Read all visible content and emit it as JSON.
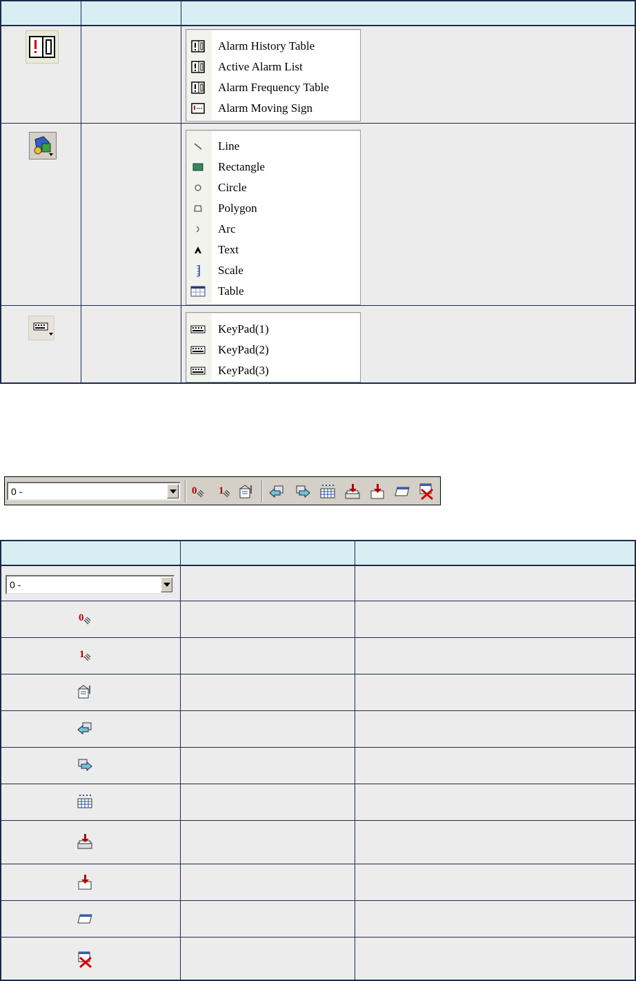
{
  "table1": {
    "headers": [
      "",
      "",
      ""
    ],
    "rows": [
      {
        "icon": "alarm-icon",
        "menu": [
          {
            "icon": "alarm-history-icon",
            "label": "Alarm History Table"
          },
          {
            "icon": "active-alarm-icon",
            "label": "Active Alarm List"
          },
          {
            "icon": "alarm-frequency-icon",
            "label": "Alarm Frequency Table"
          },
          {
            "icon": "alarm-moving-sign-icon",
            "label": "Alarm Moving Sign"
          }
        ]
      },
      {
        "icon": "drawing-tools-icon",
        "menu": [
          {
            "icon": "line-icon",
            "label": "Line"
          },
          {
            "icon": "rectangle-icon",
            "label": "Rectangle"
          },
          {
            "icon": "circle-icon",
            "label": "Circle"
          },
          {
            "icon": "polygon-icon",
            "label": "Polygon"
          },
          {
            "icon": "arc-icon",
            "label": "Arc"
          },
          {
            "icon": "text-icon",
            "label": "Text"
          },
          {
            "icon": "scale-icon",
            "label": "Scale"
          },
          {
            "icon": "table-icon",
            "label": "Table"
          }
        ]
      },
      {
        "icon": "keypad-icon",
        "menu": [
          {
            "icon": "keypad-item-icon",
            "label": "KeyPad(1)"
          },
          {
            "icon": "keypad-item-icon",
            "label": "KeyPad(2)"
          },
          {
            "icon": "keypad-item-icon",
            "label": "KeyPad(3)"
          }
        ]
      }
    ]
  },
  "toolbar": {
    "combo_value": "0 -",
    "buttons": [
      "state-0-icon",
      "state-1-icon",
      "properties-icon",
      "move-back-icon",
      "move-forward-icon",
      "align-grid-icon",
      "bring-front-icon",
      "send-back-icon",
      "window-icon",
      "delete-icon"
    ]
  },
  "table2": {
    "headers": [
      "",
      "",
      ""
    ],
    "combo_value": "0 -",
    "rows": [
      "combo",
      "state-0-icon",
      "state-1-icon",
      "properties-icon",
      "move-back-icon",
      "move-forward-icon",
      "align-grid-icon",
      "bring-front-icon",
      "send-back-icon",
      "window-icon",
      "delete-icon"
    ]
  },
  "colors": {
    "header": "#d9eef3",
    "cell": "#ececec",
    "border": "#1a2a4a",
    "toolbar": "#d4d0c8"
  }
}
